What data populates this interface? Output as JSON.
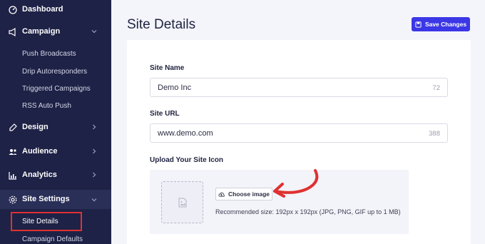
{
  "sidebar": {
    "dashboard": "Dashboard",
    "campaign": "Campaign",
    "campaign_items": [
      "Push Broadcasts",
      "Drip Autoresponders",
      "Triggered Campaigns",
      "RSS Auto Push"
    ],
    "design": "Design",
    "audience": "Audience",
    "analytics": "Analytics",
    "site_settings": "Site Settings",
    "site_settings_items": [
      "Site Details",
      "Campaign Defaults"
    ]
  },
  "main": {
    "title": "Site Details",
    "save_label": "Save Changes",
    "site_name_label": "Site Name",
    "site_name_value": "Demo Inc",
    "site_name_count": "72",
    "site_url_label": "Site URL",
    "site_url_value": "www.demo.com",
    "site_url_count": "388",
    "upload_label": "Upload Your Site Icon",
    "choose_label": "Choose image",
    "recommend_text": "Recommended size: 192px x 192px (JPG, PNG, GIF up to 1 MB)"
  },
  "colors": {
    "sidebar_bg": "#1e2246",
    "accent": "#3b37e6",
    "highlight_box": "#e03131"
  }
}
